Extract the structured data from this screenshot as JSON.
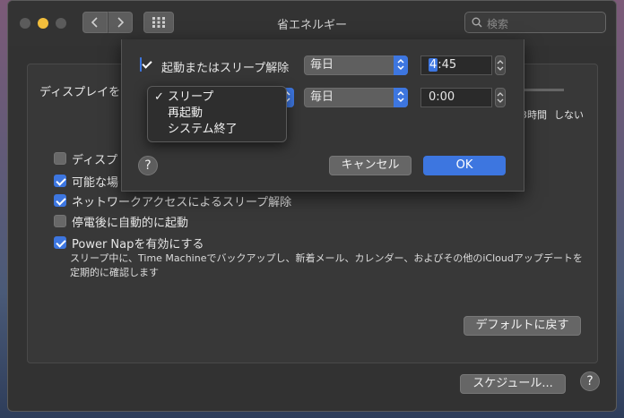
{
  "window": {
    "title": "省エネルギー"
  },
  "search": {
    "placeholder": "検索"
  },
  "panel": {
    "display_label": "ディスプレイを",
    "slider_ticks": [
      "3時間",
      "しない"
    ],
    "options": [
      {
        "label": "ディスプ",
        "checked": false
      },
      {
        "label": "可能な場",
        "checked": true
      },
      {
        "label": "ネットワークアクセスによるスリープ解除",
        "checked": true
      },
      {
        "label": "停電後に自動的に起動",
        "checked": false
      },
      {
        "label": "Power Napを有効にする",
        "checked": true
      }
    ],
    "power_nap_desc": "スリープ中に、Time Machineでバックアップし、新着メール、カレンダー、およびその他のiCloudアップデートを定期的に確認します",
    "default_button": "デフォルトに戻す",
    "schedule_button": "スケジュール...",
    "help": "?"
  },
  "sheet": {
    "row1": {
      "label": "起動またはスリープ解除",
      "checked": true,
      "frequency": "毎日",
      "time_hour": "4",
      "time_rest": ":45"
    },
    "row2": {
      "checked": true,
      "frequency": "毎日",
      "time": "0:00"
    },
    "help": "?",
    "cancel": "キャンセル",
    "ok": "OK"
  },
  "menu": {
    "selected": "スリープ",
    "items": [
      "スリープ",
      "再起動",
      "システム終了"
    ]
  },
  "colors": {
    "accent": "#3d76e0",
    "minimize": "#f2be3c"
  }
}
